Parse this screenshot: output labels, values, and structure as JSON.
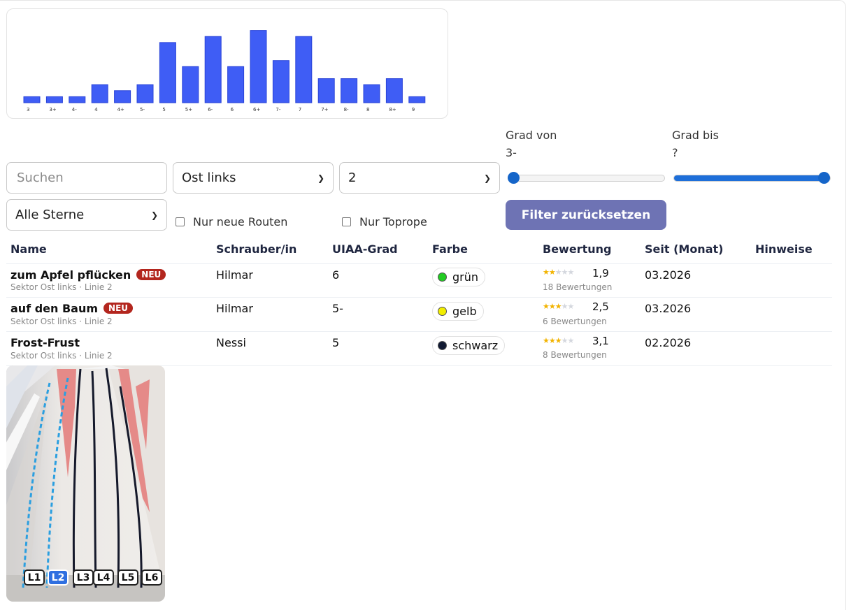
{
  "chart_data": {
    "type": "bar",
    "categories": [
      "3",
      "3+",
      "4-",
      "4",
      "4+",
      "5-",
      "5",
      "5+",
      "6-",
      "6",
      "6+",
      "7-",
      "7",
      "7+",
      "8-",
      "8",
      "8+",
      "9"
    ],
    "values": [
      1,
      1,
      1,
      3,
      2,
      3,
      10,
      6,
      11,
      6,
      12,
      7,
      11,
      4,
      4,
      3,
      4,
      1
    ],
    "title": "",
    "xlabel": "",
    "ylabel": "",
    "ylim": [
      0,
      13
    ],
    "color": "#3f5df5"
  },
  "filters": {
    "search_placeholder": "Suchen",
    "sector_value": "Ost links",
    "line_value": "2",
    "stars_value": "Alle Sterne",
    "only_new_label": "Nur neue Routen",
    "only_toprope_label": "Nur Toprope",
    "grade_from_label": "Grad von",
    "grade_from_value": "3-",
    "grade_to_label": "Grad bis",
    "grade_to_value": "?",
    "grade_from_level": 0.03,
    "grade_to_level": 0.97,
    "reset_label": "Filter zurücksetzen"
  },
  "table": {
    "headers": [
      "Name",
      "Schrauber/in",
      "UIAA-Grad",
      "Farbe",
      "Bewertung",
      "Seit (Monat)",
      "Hinweise"
    ],
    "rows": [
      {
        "name": "zum Apfel pflücken",
        "new": "NEU",
        "sub": "Sektor Ost links · Linie 2",
        "setter": "Hilmar",
        "grade": "6",
        "color_name": "grün",
        "color": "#22cc22",
        "rating": "1,9",
        "rating_value": 1.9,
        "reviews": "18 Bewertungen",
        "since": "03.2026",
        "notes": ""
      },
      {
        "name": "auf den Baum",
        "new": "NEU",
        "sub": "Sektor Ost links · Linie 2",
        "setter": "Hilmar",
        "grade": "5-",
        "color_name": "gelb",
        "color": "#f2ee00",
        "rating": "2,5",
        "rating_value": 2.5,
        "reviews": "6 Bewertungen",
        "since": "03.2026",
        "notes": ""
      },
      {
        "name": "Frost-Frust",
        "new": "",
        "sub": "Sektor Ost links · Linie 2",
        "setter": "Nessi",
        "grade": "5",
        "color_name": "schwarz",
        "color": "#111a33",
        "rating": "3,1",
        "rating_value": 3.1,
        "reviews": "8 Bewertungen",
        "since": "02.2026",
        "notes": ""
      }
    ]
  },
  "wall_map": {
    "lines": [
      "L1",
      "L2",
      "L3",
      "L4",
      "L5",
      "L6"
    ],
    "selected": "L2"
  },
  "icons": [
    "chevron-down-icon",
    "star-icon"
  ]
}
